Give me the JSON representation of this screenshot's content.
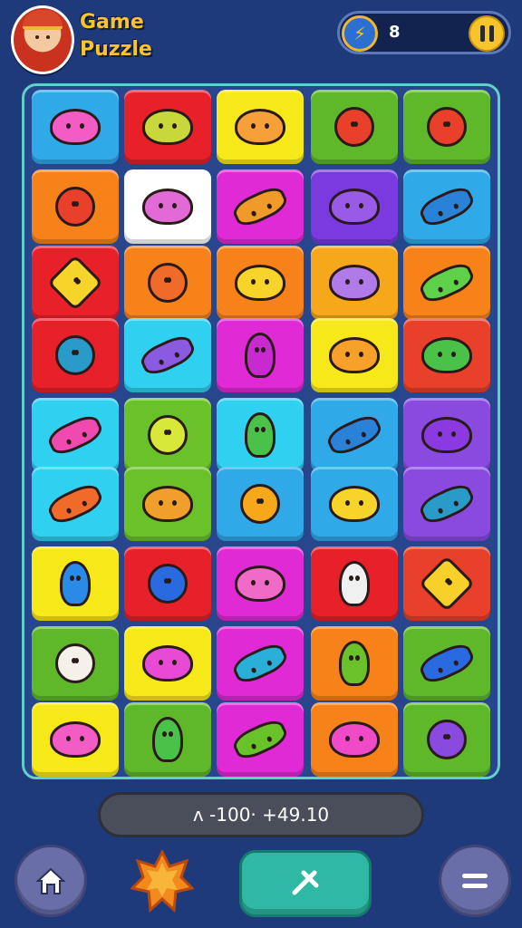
{
  "header": {
    "title": "Game Puzzle",
    "counter": "8",
    "avatar_icon": "chef-avatar-icon",
    "bolt_icon": "lightning-bolt-icon",
    "pause_icon": "pause-icon"
  },
  "colors": {
    "background": "#1f3a7a",
    "board_border": "#5fd1c8",
    "title": "#f7c32e",
    "pause_button": "#f7c52a",
    "action_button": "#2fb9a4"
  },
  "board": {
    "rows": 9,
    "cols": 5,
    "tiles": [
      [
        "#2fa9e8",
        "#e8202a",
        "#f7e81a",
        "#5fb82a",
        "#5fb82a"
      ],
      [
        "#f7821a",
        "#ffffff",
        "#e02ad6",
        "#7a3ae0",
        "#2fa9e8"
      ],
      [
        "#e8202a",
        "#f7821a",
        "#f7821a",
        "#f7a81a",
        "#f7821a"
      ],
      [
        "#e8202a",
        "#2fd0f0",
        "#e02ad6",
        "#f7e81a",
        "#e8402a"
      ],
      [
        "#2fd0f0",
        "#6ac22a",
        "#2fd0f0",
        "#2fa9e8",
        "#8a4ae0"
      ],
      [
        "#2fd0f0",
        "#6ac22a",
        "#2fa9e8",
        "#2fa9e8",
        "#8a4ae0"
      ],
      [
        "#f7e81a",
        "#e8202a",
        "#e02ad6",
        "#e8202a",
        "#e8402a"
      ],
      [
        "#5fb82a",
        "#f7e81a",
        "#e02ad6",
        "#f7821a",
        "#5fb82a"
      ],
      [
        "#f7e81a",
        "#5fb82a",
        "#e02ad6",
        "#f7821a",
        "#5fb82a"
      ]
    ],
    "pieces": [
      [
        "#f25cc4",
        "#c8d83a",
        "#f7a03a",
        "#e8402a",
        "#e8402a"
      ],
      [
        "#e8402a",
        "#e26ad6",
        "#f09a2a",
        "#9a5ae8",
        "#2a82d8"
      ],
      [
        "#f7d42a",
        "#f06a2a",
        "#f7d42a",
        "#b07ae8",
        "#5fd04a"
      ],
      [
        "#2a9ac8",
        "#8a5ae0",
        "#c82ad0",
        "#f7a02a",
        "#4ac24a"
      ],
      [
        "#f04ab0",
        "#d8e83a",
        "#4ac24a",
        "#2a82d8",
        "#8a3ae0"
      ],
      [
        "#f06a2a",
        "#f0a02a",
        "#f7a81a",
        "#f7d42a",
        "#2a9ac8"
      ],
      [
        "#2a8ae8",
        "#2a6ae0",
        "#f06ac8",
        "#f0f0f0",
        "#f7d02a"
      ],
      [
        "#f5f0e8",
        "#e84ad6",
        "#2ab0d8",
        "#6ac22a",
        "#2a6ae0"
      ],
      [
        "#f25cc4",
        "#4ac24a",
        "#6ac22a",
        "#f04ac8",
        "#8a4ae0"
      ]
    ],
    "shapes": [
      [
        "blob",
        "blob",
        "blob",
        "round",
        "round"
      ],
      [
        "round",
        "blob",
        "long",
        "blob",
        "long"
      ],
      [
        "star",
        "round",
        "blob",
        "blob",
        "long"
      ],
      [
        "round",
        "long",
        "tall",
        "blob",
        "blob"
      ],
      [
        "long",
        "round",
        "tall",
        "long",
        "blob"
      ],
      [
        "long",
        "blob",
        "round",
        "blob",
        "long"
      ],
      [
        "tall",
        "round",
        "blob",
        "tall",
        "star"
      ],
      [
        "round",
        "blob",
        "long",
        "tall",
        "long"
      ],
      [
        "blob",
        "tall",
        "long",
        "blob",
        "round"
      ]
    ]
  },
  "footer": {
    "score_text": "ʌ -100· +49.10",
    "home_icon": "home-icon",
    "burst_icon": "star-burst-icon",
    "action_icon": "hammer-icon",
    "menu_icon": "menu-icon"
  }
}
